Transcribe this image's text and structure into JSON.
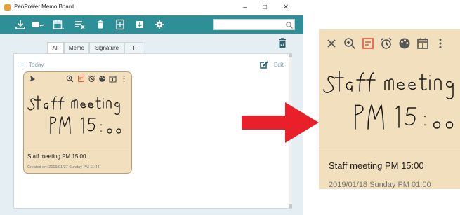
{
  "window": {
    "title": "PenPower Memo Board",
    "minimize": "–",
    "maximize": "□",
    "close": "✕"
  },
  "toolbar": {
    "icons": [
      "download-icon",
      "handwrite-icon",
      "calendar-icon",
      "list-icon",
      "delete-icon",
      "layout-icon",
      "import-icon",
      "settings-icon"
    ],
    "search_value": ""
  },
  "tabs": [
    "All",
    "Memo",
    "Signature",
    "+"
  ],
  "header": {
    "today": "Today",
    "edit": "Edit"
  },
  "memo": {
    "title": "Staff meeting PM 15:00",
    "created": "Created on: 2019/01/27 Sunday PM 11:44",
    "handwriting_line1": "Staff meeting",
    "handwriting_line2": "PM 15:00",
    "card_icons": [
      "pin-icon",
      "zoom-in-icon",
      "note-icon",
      "alarm-icon",
      "palette-icon",
      "calendar-icon",
      "more-icon"
    ],
    "color": "#f2dfbd"
  },
  "zoom_view": {
    "icons": [
      "close-icon",
      "zoom-in-icon",
      "note-icon",
      "alarm-icon",
      "palette-icon",
      "calendar-icon",
      "more-icon"
    ],
    "title": "Staff meeting PM 15:00",
    "date": "2019/01/18 Sunday PM 01:00"
  },
  "colors": {
    "toolbar": "#2f8f96",
    "background": "#e5eef2",
    "accent_red": "#e8202a",
    "note_icon": "#e8583a"
  }
}
